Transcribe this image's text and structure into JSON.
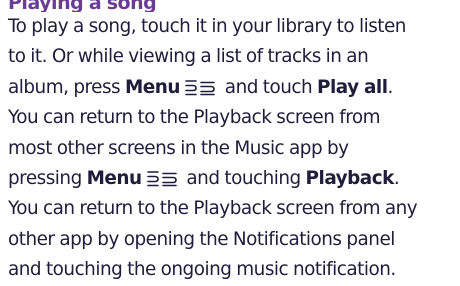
{
  "heading": "Playing a song",
  "lines": [
    {
      "text": "To play a song, touch it in your library to listen"
    },
    {
      "text": "to it. Or while viewing a list of tracks in an"
    },
    {
      "pre": "album, press ",
      "bold1": "Menu",
      "mid": " and touch ",
      "bold2": "Play all",
      "post": "."
    },
    {
      "text": "You can return to the Playback screen from"
    },
    {
      "text": "most other screens in the Music app by"
    },
    {
      "pre": "pressing ",
      "bold1": "Menu",
      "mid": " and touching ",
      "bold2": "Playback",
      "post": "."
    },
    {
      "text": "You can return to the Playback screen from any"
    },
    {
      "text": "other app by opening the Notifications panel"
    },
    {
      "text": "and touching the ongoing music notification."
    }
  ],
  "icons": {
    "menu_key": "menu-key-icon"
  },
  "colors": {
    "text": "#1f1d3a",
    "heading": "#6a3c96"
  }
}
